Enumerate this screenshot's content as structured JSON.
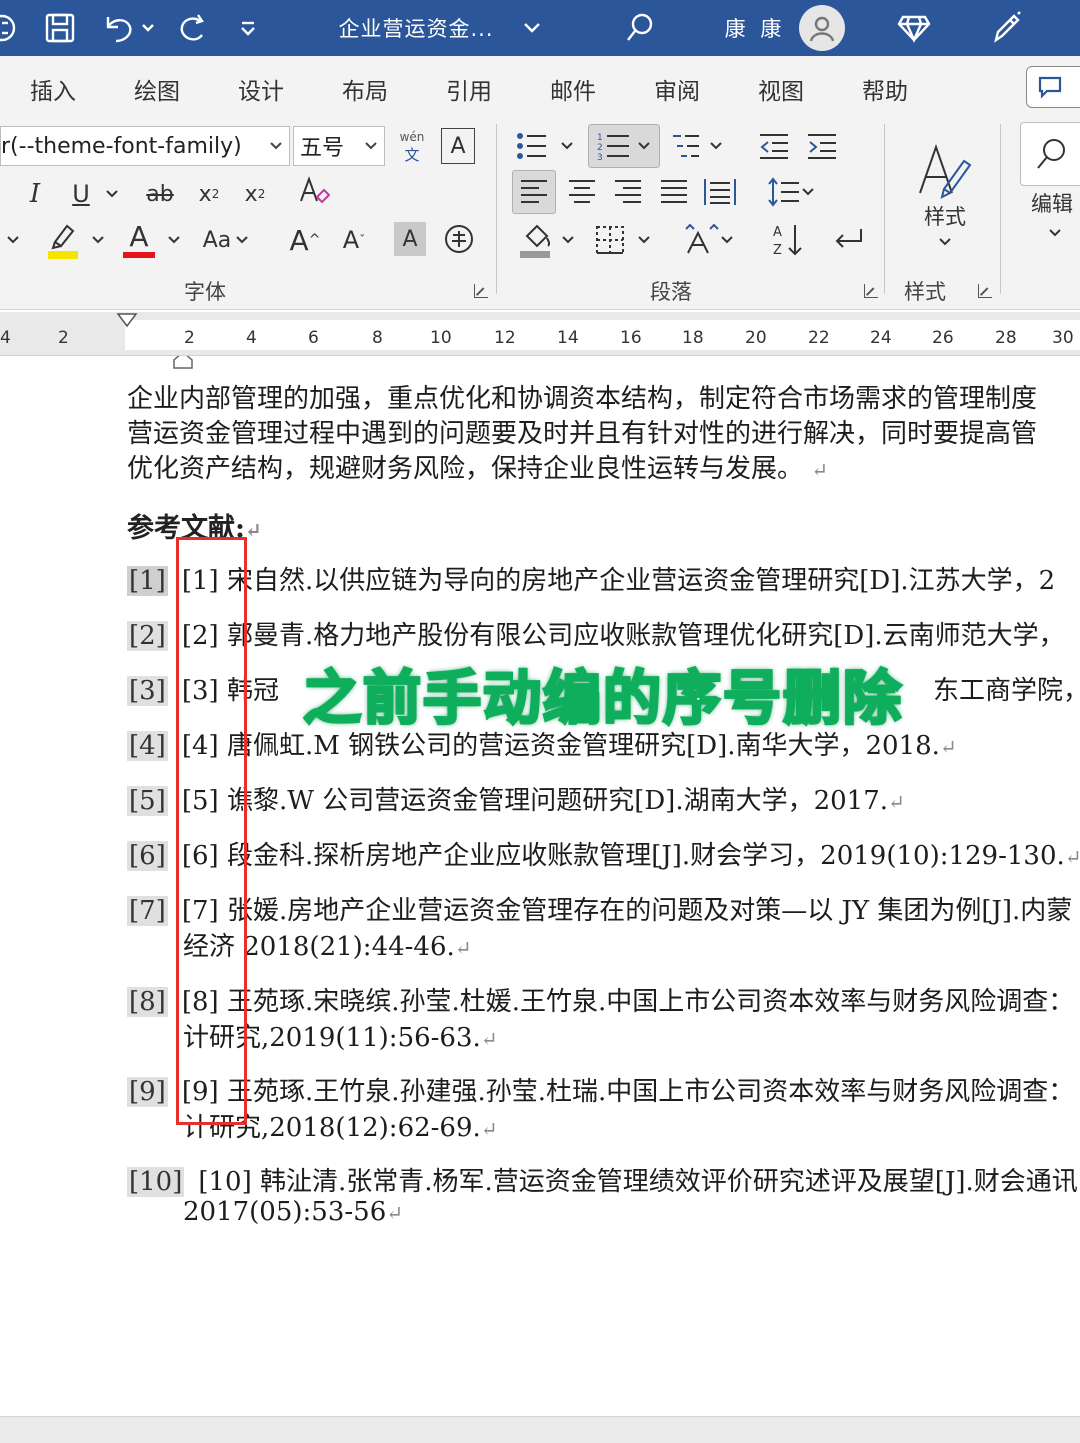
{
  "titlebar": {
    "doc_title": "企业营运资金...",
    "user_name": "康 康"
  },
  "tabs": [
    "插入",
    "绘图",
    "设计",
    "布局",
    "引用",
    "邮件",
    "审阅",
    "视图",
    "帮助"
  ],
  "ribbon": {
    "font_name": "r(--theme-font-family)",
    "font_size": "五号",
    "wen_label": "wén",
    "wen_char": "文",
    "font_group_label": "字体",
    "paragraph_group_label": "段落",
    "styles_label": "样式",
    "styles_group_label": "样式",
    "edit_label": "编辑",
    "case_label": "Aa"
  },
  "ruler_marks": [
    "4",
    "2",
    "2",
    "4",
    "6",
    "8",
    "10",
    "12",
    "14",
    "16",
    "18",
    "20",
    "22",
    "24",
    "26",
    "28",
    "30"
  ],
  "document": {
    "body_lines": [
      "企业内部管理的加强，重点优化和协调资本结构，制定符合市场需求的管理制度",
      "营运资金管理过程中遇到的问题要及时并且有针对性的进行解决，同时要提高管",
      "优化资产结构，规避财务风险，保持企业良性运转与发展。"
    ],
    "references_title": "参考文献:",
    "references": [
      {
        "num": "[1]",
        "line1": "[1] 宋自然.以供应链为导向的房地产企业营运资金管理研究[D].江苏大学，2",
        "line2": ""
      },
      {
        "num": "[2]",
        "line1": "[2] 郭曼青.格力地产股份有限公司应收账款管理优化研究[D].云南师范大学，",
        "line2": ""
      },
      {
        "num": "[3]",
        "line1": "[3] 韩冠",
        "line1b": "东工商学院，",
        "line2": ""
      },
      {
        "num": "[4]",
        "line1": "[4] 唐佩虹.M 钢铁公司的营运资金管理研究[D].南华大学，2018.",
        "line2": ""
      },
      {
        "num": "[5]",
        "line1": "[5] 谯黎.W 公司营运资金管理问题研究[D].湖南大学，2017.",
        "line2": ""
      },
      {
        "num": "[6]",
        "line1": "[6] 段金科.探析房地产企业应收账款管理[J].财会学习，2019(10):129-130.",
        "line2": ""
      },
      {
        "num": "[7]",
        "line1": "[7] 张媛.房地产企业营运资金管理存在的问题及对策—以 JY 集团为例[J].内蒙",
        "line2": "经济    2018(21):44-46."
      },
      {
        "num": "[8]",
        "line1": "[8] 王苑琢.宋晓缤.孙莹.杜媛.王竹泉.中国上市公司资本效率与财务风险调查：",
        "line2": "计研究,2019(11):56-63."
      },
      {
        "num": "[9]",
        "line1": "[9] 王苑琢.王竹泉.孙建强.孙莹.杜瑞.中国上市公司资本效率与财务风险调查：",
        "line2": "计研究,2018(12):62-69."
      },
      {
        "num": "[10]",
        "line1": "[10] 韩沚清.张常青.杨军.营运资金管理绩效评价研究述评及展望[J].财会通讯",
        "line2": "2017(05):53-56"
      }
    ]
  },
  "overlay": {
    "caption": "之前手动编的序号删除"
  },
  "colors": {
    "title_bar": "#2b579a",
    "annotation_box": "#e8302b",
    "caption_outline": "#0fae5c"
  }
}
